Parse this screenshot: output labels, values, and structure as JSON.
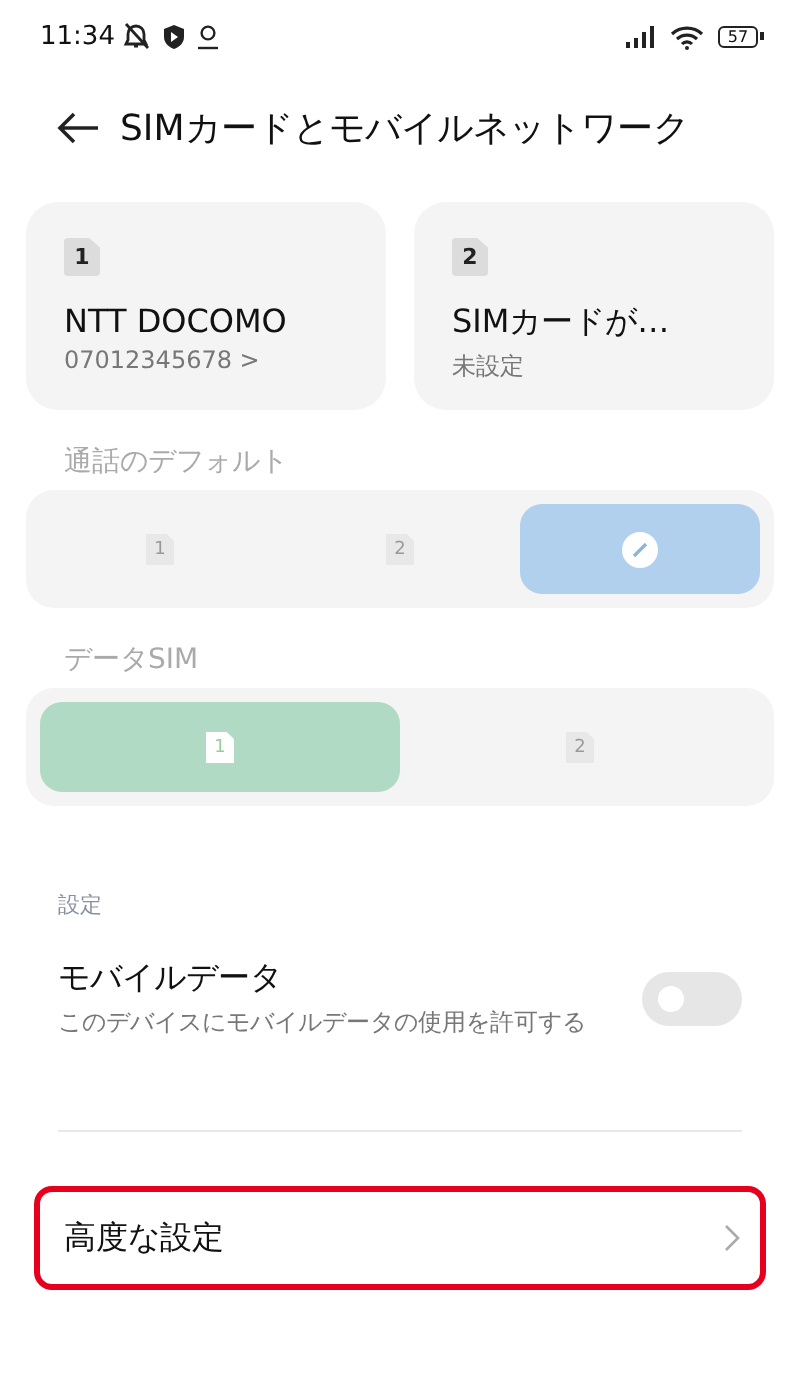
{
  "status_bar": {
    "time": "11:34",
    "battery": "57"
  },
  "header": {
    "title": "SIMカードとモバイルネットワーク"
  },
  "sim_cards": [
    {
      "slot": "1",
      "name": "NTT DOCOMO",
      "detail": "07012345678 >"
    },
    {
      "slot": "2",
      "name": "SIMカードが…",
      "detail": "未設定"
    }
  ],
  "call_default": {
    "label": "通話のデフォルト",
    "options": [
      {
        "kind": "sim",
        "label": "1",
        "selected": false
      },
      {
        "kind": "sim",
        "label": "2",
        "selected": false
      },
      {
        "kind": "ask",
        "selected": true
      }
    ]
  },
  "data_sim": {
    "label": "データSIM",
    "options": [
      {
        "kind": "sim",
        "label": "1",
        "selected": true
      },
      {
        "kind": "sim",
        "label": "2",
        "selected": false
      }
    ]
  },
  "settings": {
    "heading": "設定",
    "items": [
      {
        "kind": "toggle",
        "title": "モバイルデータ",
        "subtitle": "このデバイスにモバイルデータの使用を許可する",
        "on": false
      },
      {
        "kind": "link",
        "title": "高度な設定",
        "highlighted": true
      }
    ]
  }
}
